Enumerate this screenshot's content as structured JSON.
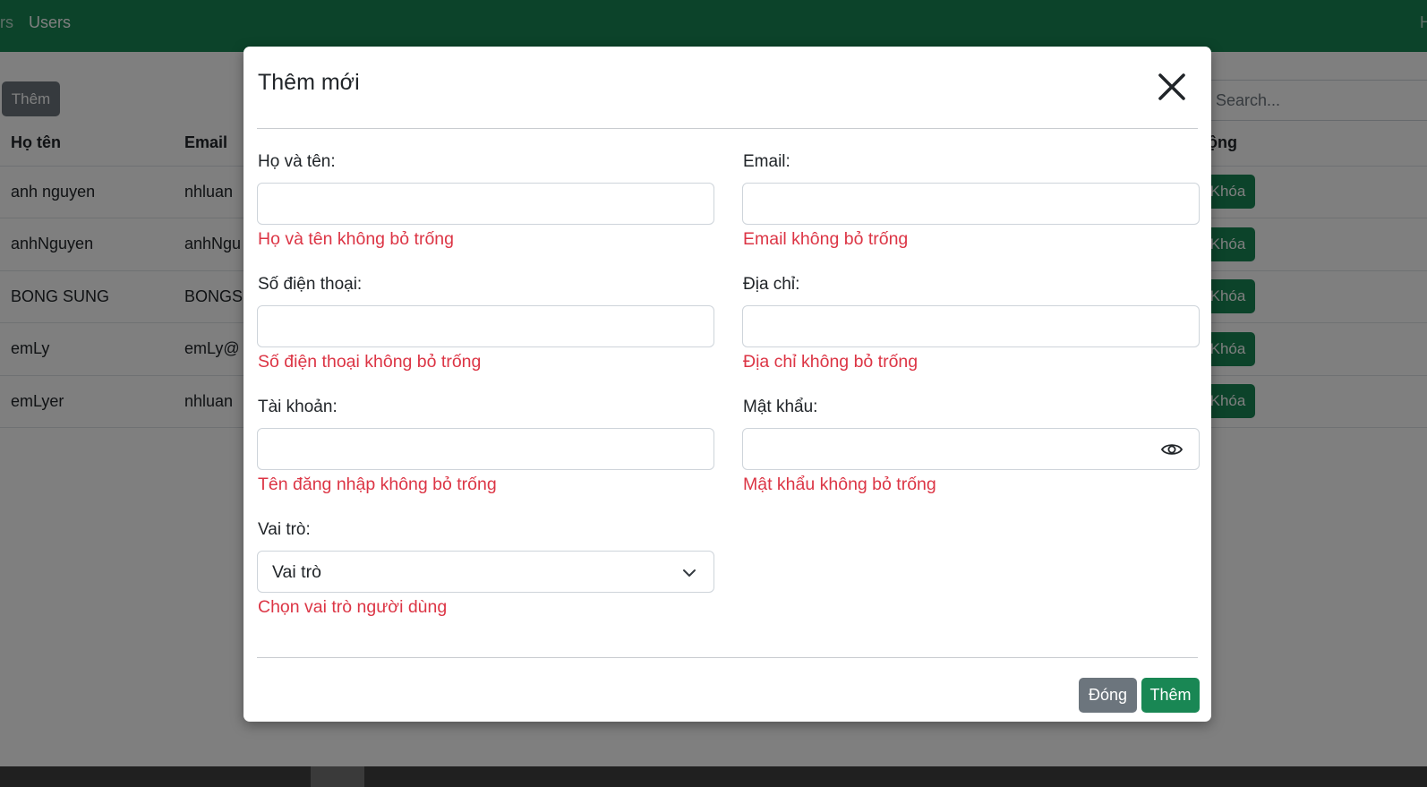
{
  "navbar": {
    "left_fragment": "rs",
    "users_link": "Users",
    "right_fragment": "H"
  },
  "page": {
    "add_button": "Thêm",
    "search_placeholder": "Search...",
    "table": {
      "headers": {
        "name": "Họ tên",
        "email": "Email",
        "actions": "động"
      },
      "rows": [
        {
          "name": "anh nguyen",
          "email": "nhluan",
          "lock": "Khóa"
        },
        {
          "name": "anhNguyen",
          "email": "anhNgu",
          "lock": "Khóa"
        },
        {
          "name": "BONG SUNG",
          "email": "BONGS",
          "lock": "Khóa"
        },
        {
          "name": "emLy",
          "email": "emLy@",
          "lock": "Khóa"
        },
        {
          "name": "emLyer",
          "email": "nhluan",
          "lock": "Khóa"
        }
      ]
    }
  },
  "modal": {
    "title": "Thêm mới",
    "fields": {
      "fullname": {
        "label": "Họ và tên:",
        "value": "",
        "error": "Họ và tên không bỏ trống"
      },
      "email": {
        "label": "Email:",
        "value": "",
        "error": "Email không bỏ trống"
      },
      "phone": {
        "label": "Số điện thoại:",
        "value": "",
        "error": "Số điện thoại không bỏ trống"
      },
      "address": {
        "label": "Địa chỉ:",
        "value": "",
        "error": "Địa chỉ không bỏ trống"
      },
      "username": {
        "label": "Tài khoản:",
        "value": "",
        "error": "Tên đăng nhập không bỏ trống"
      },
      "password": {
        "label": "Mật khẩu:",
        "value": "",
        "error": "Mật khẩu không bỏ trống"
      },
      "role": {
        "label": "Vai trò:",
        "selected": "Vai trò",
        "error": "Chọn vai trò người dùng"
      }
    },
    "footer": {
      "close_label": "Đóng",
      "submit_label": "Thêm"
    }
  },
  "colors": {
    "primary_green": "#198754",
    "secondary_gray": "#6c757d",
    "error_red": "#dc3545",
    "blue": "#0d6efd"
  }
}
